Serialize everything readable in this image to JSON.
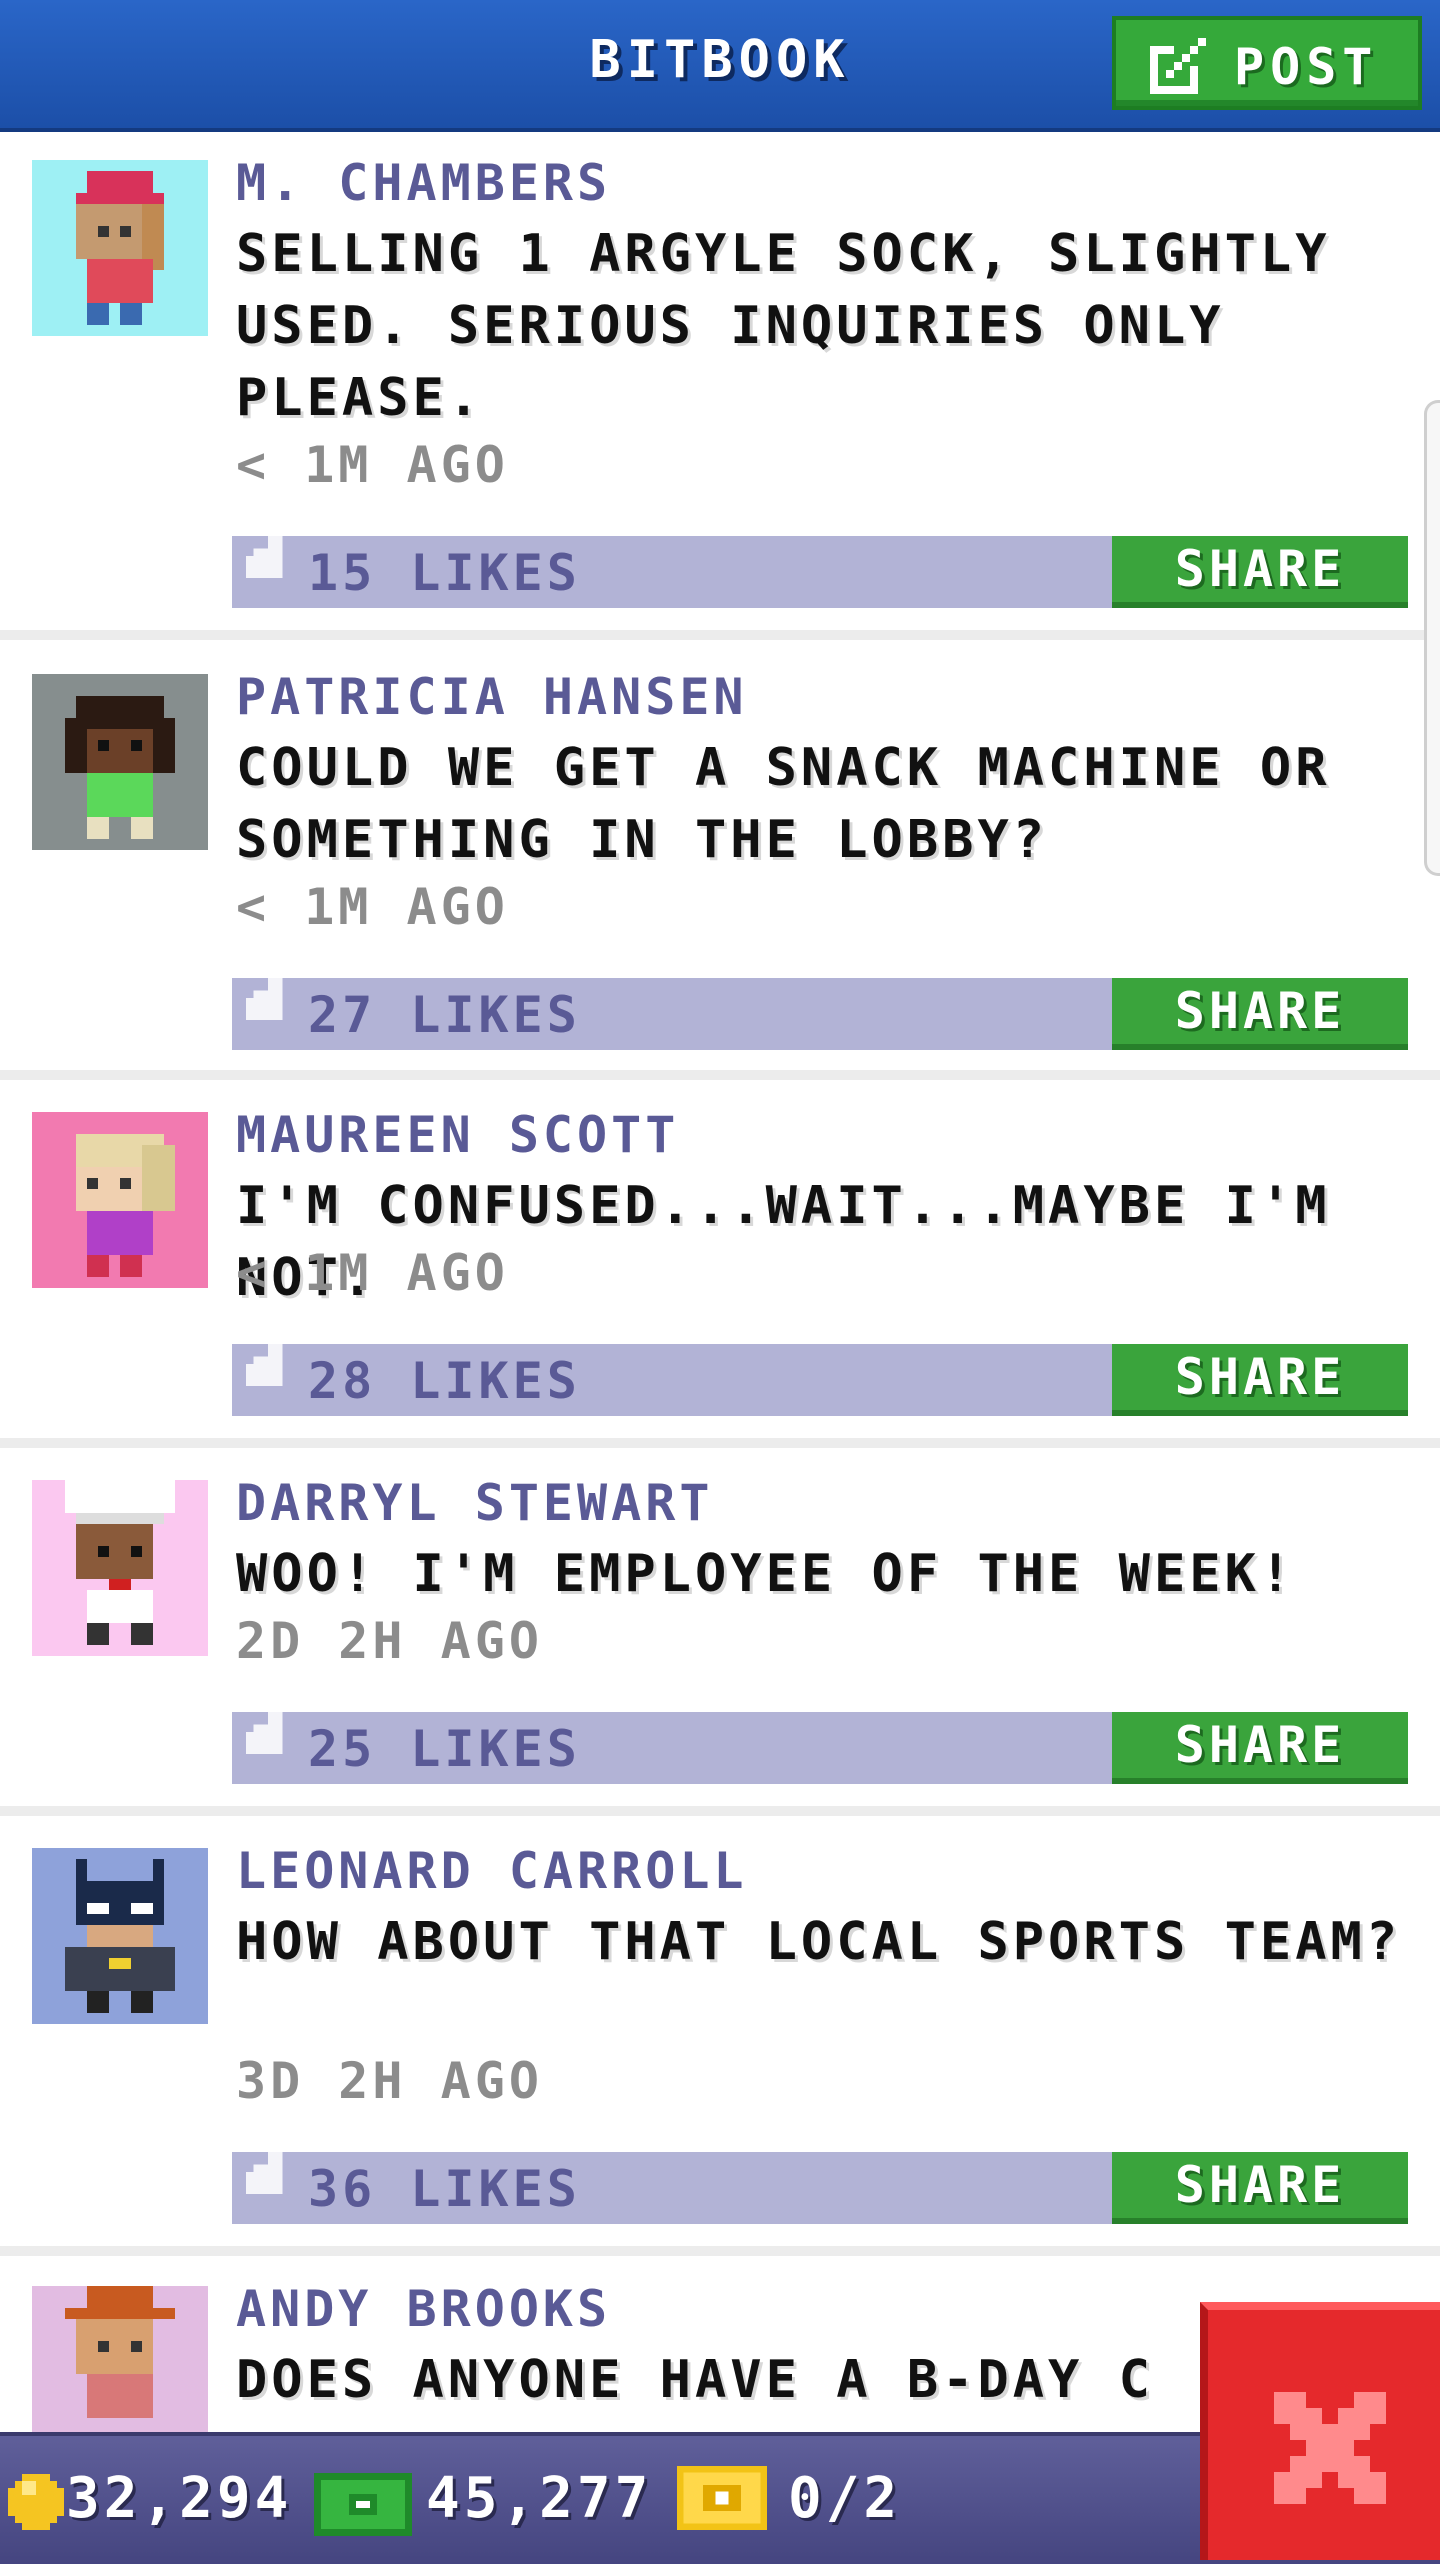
{
  "header": {
    "title": "BITBOOK",
    "post_label": "POST"
  },
  "posts": [
    {
      "author": "M. CHAMBERS",
      "message": "SELLING 1 ARGYLE SOCK, SLIGHTLY USED. SERIOUS INQUIRIES ONLY PLEASE.",
      "time": "< 1M AGO",
      "likes": "15 LIKES",
      "share_label": "SHARE",
      "avatar_icon": "avatar-red-hat-icon"
    },
    {
      "author": "PATRICIA HANSEN",
      "message": "COULD WE GET A SNACK MACHINE OR SOMETHING IN THE LOBBY?",
      "time": "< 1M AGO",
      "likes": "27 LIKES",
      "share_label": "SHARE",
      "avatar_icon": "avatar-dark-hair-icon"
    },
    {
      "author": "MAUREEN SCOTT",
      "message": "I'M CONFUSED...WAIT...MAYBE I'M NOT.",
      "time": "< 1M AGO",
      "likes": "28 LIKES",
      "share_label": "SHARE",
      "avatar_icon": "avatar-blonde-icon"
    },
    {
      "author": "DARRYL STEWART",
      "message": "WOO! I'M EMPLOYEE OF THE WEEK!",
      "time": "2D 2H AGO",
      "likes": "25 LIKES",
      "share_label": "SHARE",
      "avatar_icon": "avatar-chef-icon"
    },
    {
      "author": "LEONARD CARROLL",
      "message": "HOW ABOUT THAT LOCAL SPORTS TEAM?",
      "time": "3D 2H AGO",
      "likes": "36 LIKES",
      "share_label": "SHARE",
      "avatar_icon": "avatar-bat-mask-icon"
    },
    {
      "author": "ANDY BROOKS",
      "message": "DOES ANYONE HAVE A B-DAY C",
      "avatar_icon": "avatar-orange-hat-icon"
    }
  ],
  "footer": {
    "coins": "32,294",
    "bux": "45,277",
    "tickets": "0/2"
  },
  "colors": {
    "header_blue": "#2a66c8",
    "button_green": "#3aa43c",
    "like_bar": "#b2b3d6",
    "author_text": "#5a5a96",
    "close_red": "#e5292c"
  }
}
